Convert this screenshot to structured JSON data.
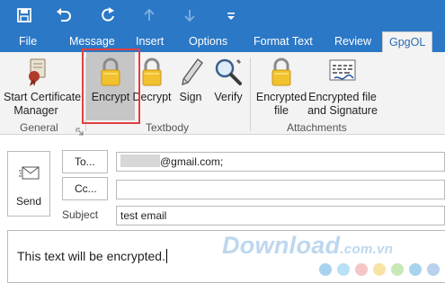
{
  "tabs": [
    {
      "label": "File"
    },
    {
      "label": "Message"
    },
    {
      "label": "Insert"
    },
    {
      "label": "Options"
    },
    {
      "label": "Format Text"
    },
    {
      "label": "Review"
    },
    {
      "label": "GpgOL"
    }
  ],
  "ribbon": {
    "buttons": [
      {
        "label": "Start Certificate",
        "label2": "Manager",
        "icon": "certificate-icon"
      },
      {
        "label": "Encrypt",
        "icon": "lock-icon",
        "highlighted": true
      },
      {
        "label": "Decrypt",
        "icon": "lock-icon"
      },
      {
        "label": "Sign",
        "icon": "pen-icon"
      },
      {
        "label": "Verify",
        "icon": "magnifier-icon"
      },
      {
        "label": "Encrypted",
        "label2": "file",
        "icon": "lock-icon"
      },
      {
        "label": "Encrypted file",
        "label2": "and Signature",
        "icon": "signed-document-icon"
      }
    ],
    "groups": [
      {
        "label": "General"
      },
      {
        "label": "Textbody"
      },
      {
        "label": "Attachments"
      }
    ]
  },
  "compose": {
    "send_label": "Send",
    "to_label": "To...",
    "to_value": "@gmail.com;",
    "cc_label": "Cc...",
    "cc_value": "",
    "subject_label": "Subject",
    "subject_value": "test email",
    "body_text": "This text will be encrypted."
  },
  "watermark": {
    "text": "Download",
    "suffix": ".com.vn",
    "dot_colors": [
      "#a8d3ee",
      "#b9e0f4",
      "#f5c6c6",
      "#f7e3a6",
      "#c9e7b7",
      "#a8d3ee",
      "#b9d0ee"
    ]
  },
  "colors": {
    "title_bar": "#2b78c6",
    "ribbon_bg": "#f3f3f3",
    "active_tab_text": "#2b6bb5",
    "highlight_box": "#e04040"
  }
}
